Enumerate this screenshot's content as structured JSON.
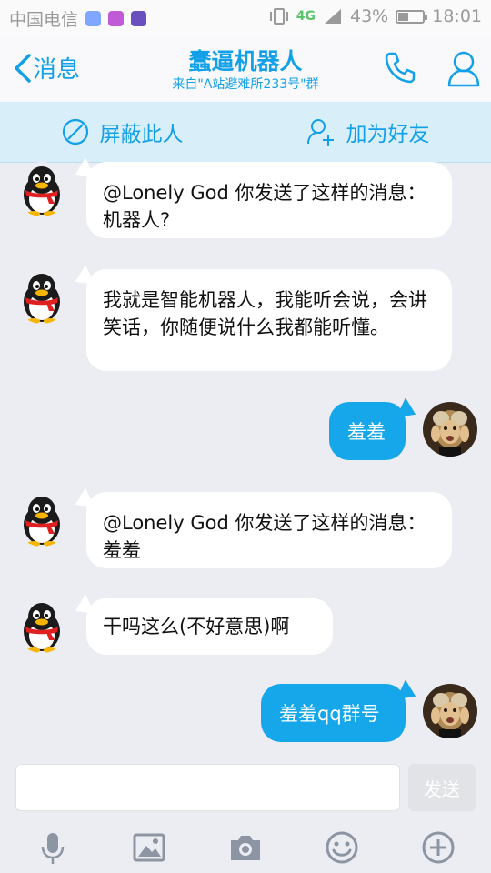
{
  "status": {
    "carrier": "中国电信",
    "network": "4G",
    "battery": "43%",
    "battery_level": 0.43,
    "time": "18:01"
  },
  "header": {
    "back_label": "消息",
    "title": "蠢逼机器人",
    "subtitle": "来自\"A站避难所233号\"群"
  },
  "actions": {
    "block_label": "屏蔽此人",
    "add_friend_label": "加为好友"
  },
  "messages": [
    {
      "side": "in",
      "text": "@Lonely God  你发送了这样的消息：机器人?"
    },
    {
      "side": "in",
      "text": "我就是智能机器人，我能听会说，会讲笑话，你随便说什么我都能听懂。"
    },
    {
      "side": "out",
      "text": "羞羞"
    },
    {
      "side": "in",
      "text": "@Lonely God  你发送了这样的消息：羞羞"
    },
    {
      "side": "in",
      "text": "干吗这么(不好意思)啊"
    },
    {
      "side": "out",
      "text": "羞羞qq群号"
    }
  ],
  "composer": {
    "placeholder": "",
    "send_label": "发送"
  },
  "colors": {
    "accent": "#12a0e8",
    "bubble_out": "#16a6ea",
    "bubble_in": "#ffffff",
    "background": "#ebedf2"
  },
  "toolbar_icons": [
    "microphone-icon",
    "image-icon",
    "camera-icon",
    "emoji-icon",
    "plus-icon"
  ]
}
